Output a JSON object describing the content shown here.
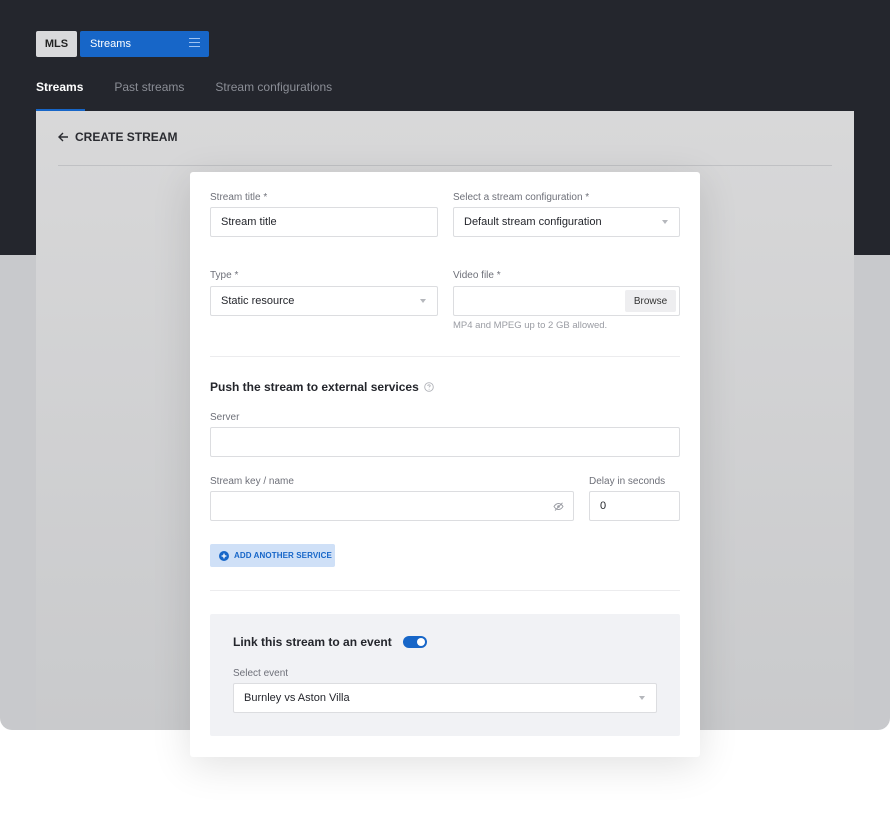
{
  "header": {
    "org_label": "MLS",
    "section_label": "Streams",
    "tabs": [
      {
        "label": "Streams",
        "active": true
      },
      {
        "label": "Past streams",
        "active": false
      },
      {
        "label": "Stream configurations",
        "active": false
      }
    ]
  },
  "page": {
    "title": "CREATE STREAM"
  },
  "form": {
    "stream_title": {
      "label": "Stream title *",
      "placeholder": "Stream title"
    },
    "stream_config": {
      "label": "Select a stream configuration *",
      "value": "Default stream configuration"
    },
    "type": {
      "label": "Type *",
      "value": "Static resource"
    },
    "video_file": {
      "label": "Video file *",
      "browse_label": "Browse",
      "hint": "MP4 and MPEG up to 2 GB allowed."
    },
    "push_section": {
      "title": "Push the stream to external services",
      "server_label": "Server",
      "stream_key_label": "Stream key / name",
      "delay_label": "Delay in seconds",
      "delay_value": "0",
      "add_service_label": "ADD ANOTHER SERVICE"
    },
    "event_section": {
      "title": "Link this stream to an event",
      "toggle_on": true,
      "select_label": "Select event",
      "selected_event": "Burnley vs Aston Villa"
    }
  },
  "colors": {
    "accent": "#1766c8",
    "topbar": "#24262d"
  }
}
